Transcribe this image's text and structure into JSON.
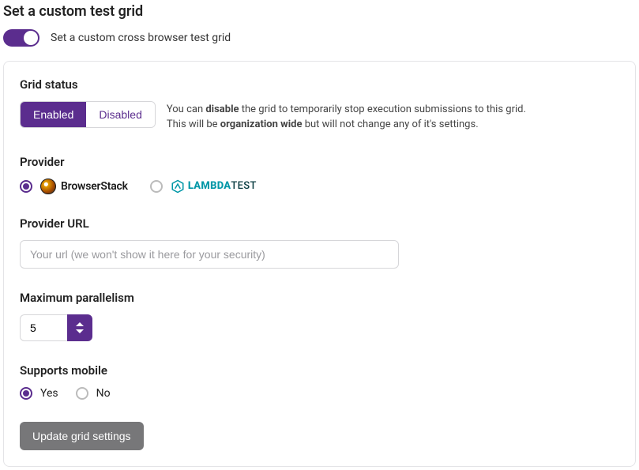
{
  "title": "Set a custom test grid",
  "toggle": {
    "label": "Set a custom cross browser test grid",
    "on": true
  },
  "gridStatus": {
    "label": "Grid status",
    "options": {
      "enabled": "Enabled",
      "disabled": "Disabled"
    },
    "selected": "enabled",
    "help_pre": "You can ",
    "help_bold1": "disable",
    "help_mid1": " the grid to temporarily stop execution submissions to this grid.",
    "help_pre2": "This will be ",
    "help_bold2": "organization wide",
    "help_mid2": " but will not change any of it's settings."
  },
  "provider": {
    "label": "Provider",
    "options": [
      {
        "id": "browserstack",
        "name": "BrowserStack",
        "selected": true
      },
      {
        "id": "lambdatest",
        "name": "LAMBDATEST",
        "selected": false
      }
    ]
  },
  "providerUrl": {
    "label": "Provider URL",
    "placeholder": "Your url (we won't show it here for your security)",
    "value": ""
  },
  "parallelism": {
    "label": "Maximum parallelism",
    "value": "5"
  },
  "supportsMobile": {
    "label": "Supports mobile",
    "yes": "Yes",
    "no": "No",
    "selected": "yes"
  },
  "updateButton": "Update grid settings"
}
